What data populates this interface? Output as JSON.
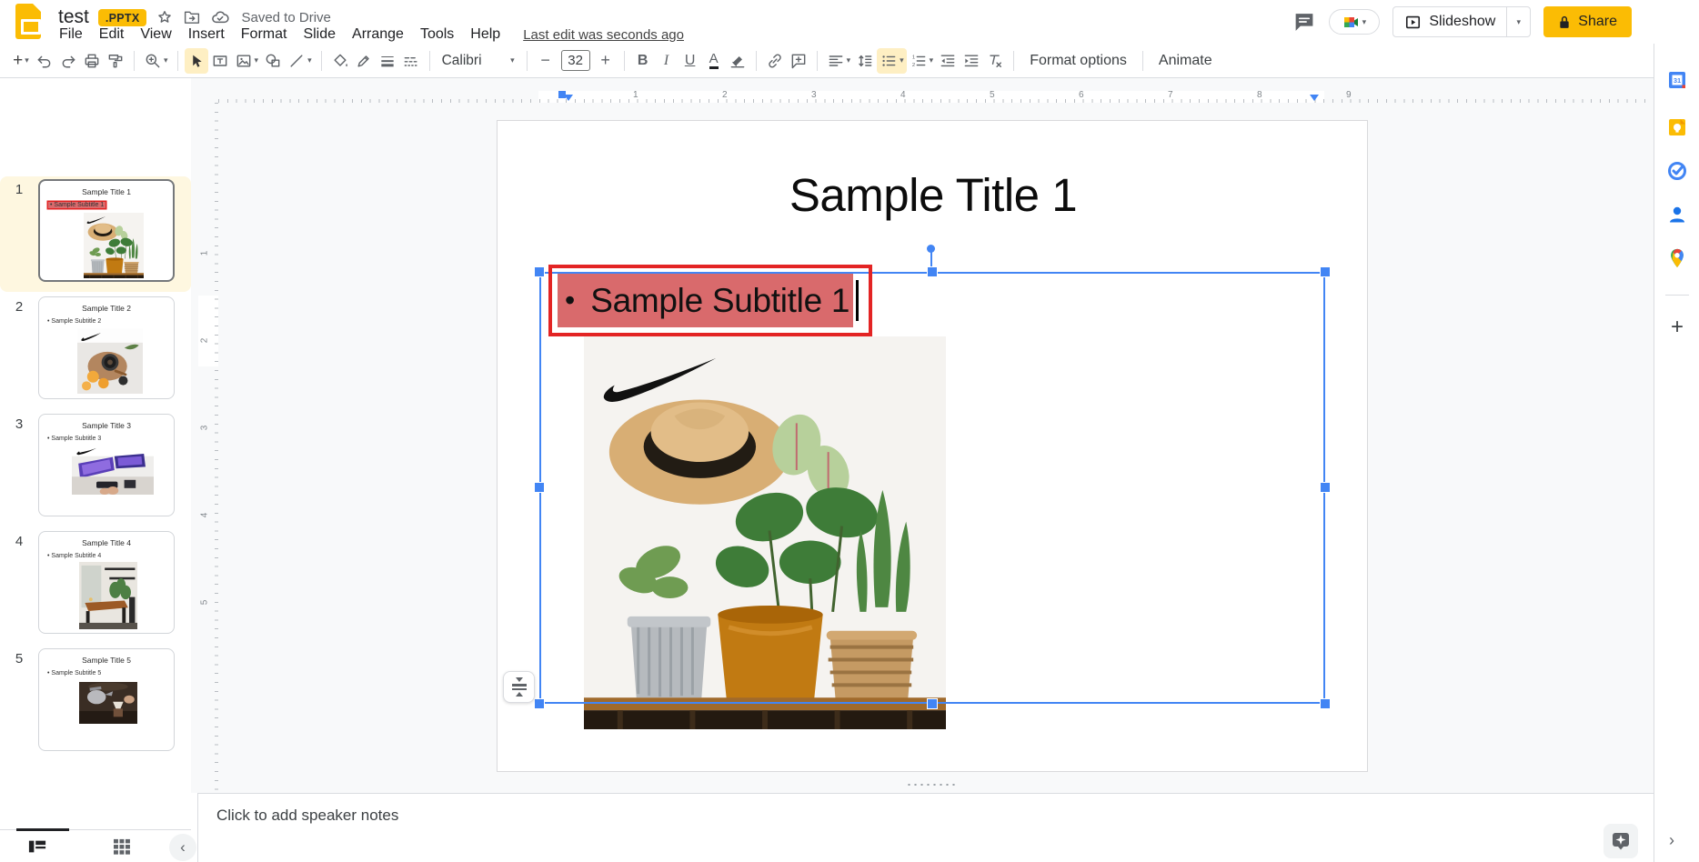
{
  "header": {
    "doc_title": "test",
    "badge": ".PPTX",
    "saved_status": "Saved to Drive",
    "menu_items": [
      "File",
      "Edit",
      "View",
      "Insert",
      "Format",
      "Slide",
      "Arrange",
      "Tools",
      "Help"
    ],
    "last_edit": "Last edit was seconds ago",
    "slideshow_label": "Slideshow",
    "share_label": "Share"
  },
  "toolbar": {
    "font_name": "Calibri",
    "font_size": "32",
    "format_options_label": "Format options",
    "animate_label": "Animate"
  },
  "filmstrip": {
    "slides": [
      {
        "num": "1",
        "title": "Sample Title 1",
        "subtitle": "Sample Subtitle 1",
        "selected": true
      },
      {
        "num": "2",
        "title": "Sample Title 2",
        "subtitle": "Sample Subtitle 2",
        "selected": false
      },
      {
        "num": "3",
        "title": "Sample Title 3",
        "subtitle": "Sample Subtitle 3",
        "selected": false
      },
      {
        "num": "4",
        "title": "Sample Title 4",
        "subtitle": "Sample Subtitle 4",
        "selected": false
      },
      {
        "num": "5",
        "title": "Sample Title 5",
        "subtitle": "Sample Subtitle 5",
        "selected": false
      }
    ]
  },
  "slide": {
    "title": "Sample Title 1",
    "bullet": "•",
    "subtitle_text": "Sample Subtitle 1"
  },
  "rulers": {
    "horizontal": [
      "1",
      "2",
      "3",
      "4",
      "5",
      "6",
      "7",
      "8",
      "9"
    ],
    "vertical": [
      "1",
      "2",
      "3",
      "4",
      "5"
    ]
  },
  "notes": {
    "placeholder": "Click to add speaker notes"
  },
  "colors": {
    "share_yellow": "#fbbc04",
    "badge_yellow": "#fbbc04",
    "selection_blue": "#4285f4",
    "highlight_red": "#d96a6c",
    "border_red": "#e32424",
    "selected_row_bg": "#fef7e0",
    "active_tool_bg": "#feefc3"
  }
}
